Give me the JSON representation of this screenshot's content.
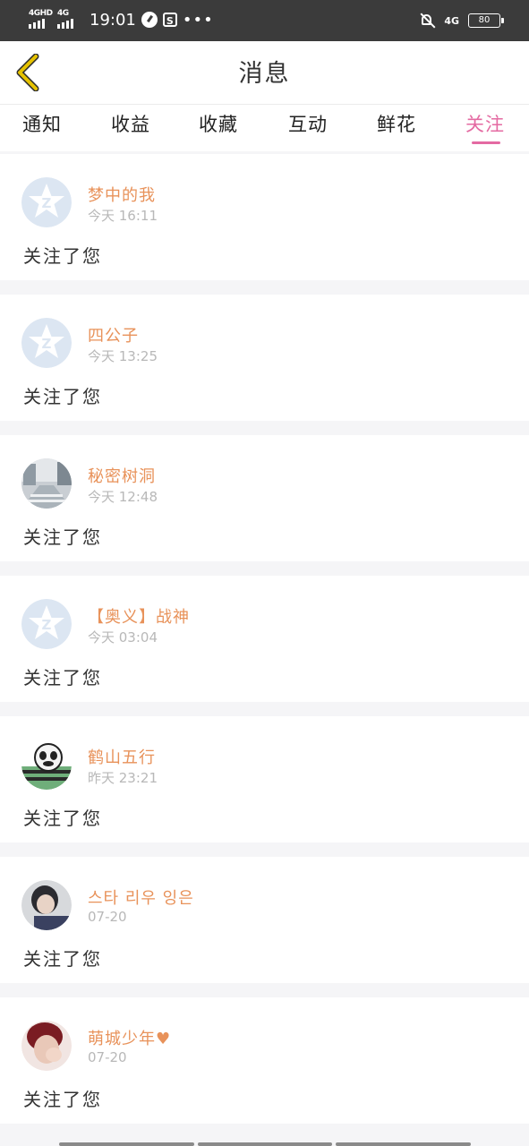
{
  "statusbar": {
    "sim1": "4GHD",
    "sim2": "4G",
    "time": "19:01",
    "net": "4G",
    "battery": "80"
  },
  "header": {
    "title": "消息"
  },
  "tabs": [
    {
      "label": "通知"
    },
    {
      "label": "收益"
    },
    {
      "label": "收藏"
    },
    {
      "label": "互动"
    },
    {
      "label": "鲜花"
    },
    {
      "label": "关注",
      "active": true
    }
  ],
  "messages": [
    {
      "name": "梦中的我",
      "time": "今天 16:11",
      "content": "关注了您",
      "avatar": "default-qq-icon"
    },
    {
      "name": "四公子",
      "time": "今天 13:25",
      "content": "关注了您",
      "avatar": "default-qq-icon"
    },
    {
      "name": "秘密树洞",
      "time": "今天 12:48",
      "content": "关注了您",
      "avatar": "street-photo"
    },
    {
      "name": "【奥义】战神",
      "time": "今天 03:04",
      "content": "关注了您",
      "avatar": "default-qq-icon"
    },
    {
      "name": "鹤山五行",
      "time": "昨天 23:21",
      "content": "关注了您",
      "avatar": "cartoon-panda"
    },
    {
      "name": "스타 리우 잉은",
      "time": "07-20",
      "content": "关注了您",
      "avatar": "person-photo"
    },
    {
      "name": "萌城少年♥",
      "time": "07-20",
      "content": "关注了您",
      "avatar": "person-photo-red"
    }
  ],
  "colors": {
    "accent": "#e46aa2",
    "name": "#e8925a",
    "back_icon": "#e0c000"
  }
}
